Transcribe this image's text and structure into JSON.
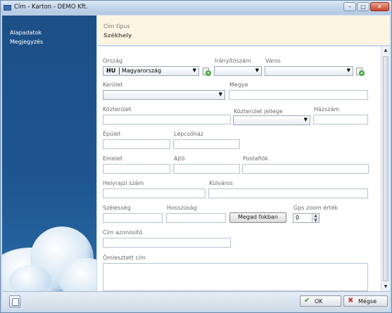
{
  "window": {
    "title": "Cím - Karton  - DEMO Kft.",
    "minimize_glyph": "–",
    "maximize_glyph": "□",
    "close_glyph": "✕"
  },
  "sidebar": {
    "items": [
      {
        "label": "Alapadatok"
      },
      {
        "label": "Megjegyzés"
      }
    ]
  },
  "header": {
    "label": "Cím típus",
    "value": "Székhely"
  },
  "form": {
    "country": {
      "label": "Ország",
      "code": "HU",
      "name": "Magyarország"
    },
    "zip": {
      "label": "Irányítószám",
      "value": ""
    },
    "city": {
      "label": "Város",
      "value": ""
    },
    "district": {
      "label": "Kerület",
      "value": ""
    },
    "county": {
      "label": "Megye",
      "value": ""
    },
    "public_area": {
      "label": "Közterület",
      "value": ""
    },
    "public_area_type": {
      "label": "Közterület jellege",
      "value": ""
    },
    "house_number": {
      "label": "Házszám",
      "value": ""
    },
    "building": {
      "label": "Épület",
      "value": ""
    },
    "staircase": {
      "label": "Lépcsőház",
      "value": ""
    },
    "floor": {
      "label": "Emelet",
      "value": ""
    },
    "door": {
      "label": "Ajtó",
      "value": ""
    },
    "po_box": {
      "label": "Postafiók",
      "value": ""
    },
    "lot_number": {
      "label": "Helyrajzi szám",
      "value": ""
    },
    "outskirts": {
      "label": "Külváros",
      "value": ""
    },
    "latitude": {
      "label": "Szélesség",
      "value": ""
    },
    "longitude": {
      "label": "Hosszúság",
      "value": ""
    },
    "find_button": "Megad fokban",
    "gps_zoom": {
      "label": "Gps zoom érték",
      "value": "0"
    },
    "address_id": {
      "label": "Cím azonosító",
      "value": ""
    },
    "combined_address": {
      "label": "Ömlesztett cím",
      "value": ""
    },
    "dropdown_arrow": "▼",
    "plus_glyph": "+"
  },
  "footer": {
    "ok_label": "OK",
    "cancel_label": "Mégse",
    "ok_icon": "✔",
    "cancel_icon": "✖"
  },
  "colors": {
    "sidebar": "#1d5690",
    "header_bg": "#fdf4e2",
    "ok_icon": "#2e9a2e",
    "cancel_icon": "#c0392b"
  }
}
